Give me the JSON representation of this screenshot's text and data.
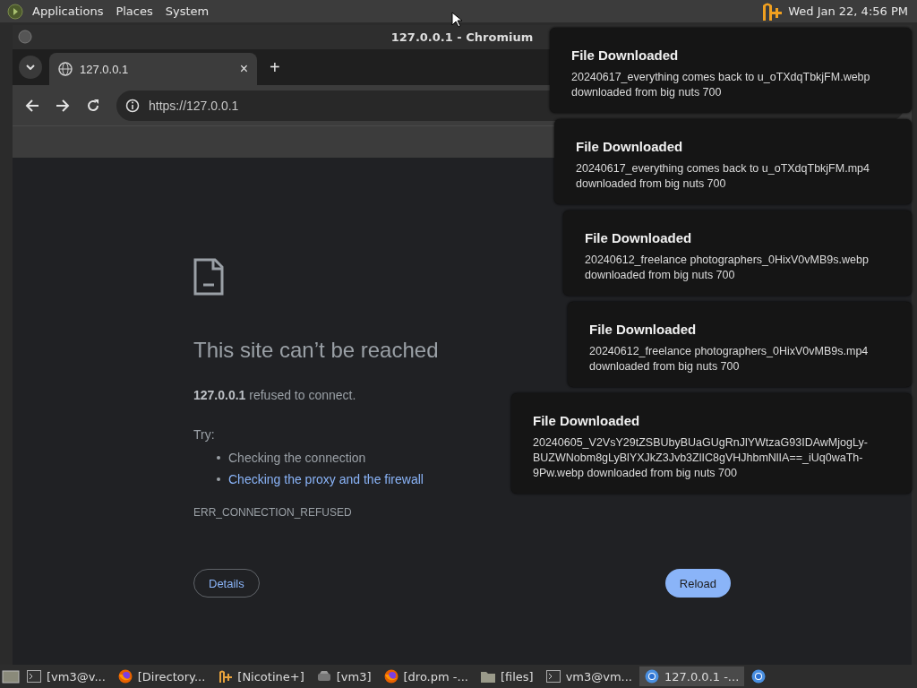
{
  "top_panel": {
    "menus": [
      "Applications",
      "Places",
      "System"
    ],
    "clock": "Wed Jan 22,  4:56 PM"
  },
  "window": {
    "title": "127.0.0.1 - Chromium"
  },
  "tabs": [
    {
      "label": "127.0.0.1",
      "close": "×",
      "selected": true
    }
  ],
  "new_tab": "+",
  "address_bar": {
    "value": "https://127.0.0.1"
  },
  "error_page": {
    "heading": "This site can’t be reached",
    "message": "**127.0.0.1** refused to connect.",
    "try_label": "Try:",
    "suggestions": [
      {
        "text": "Checking the connection",
        "kind": "text"
      },
      {
        "text": "Checking the proxy and the firewall",
        "kind": "link"
      }
    ],
    "code": "ERR_CONNECTION_REFUSED",
    "details_button": "Details",
    "reload_button": "Reload"
  },
  "notifications": [
    {
      "title": "File Downloaded",
      "body": "20240617_everything comes back to u_oTXdqTbkjFM.webp downloaded from big nuts 700"
    },
    {
      "title": "File Downloaded",
      "body": "20240617_everything comes back to u_oTXdqTbkjFM.mp4 downloaded from big nuts 700"
    },
    {
      "title": "File Downloaded",
      "body": "20240612_freelance photographers_0HixV0vMB9s.webp downloaded from big nuts 700"
    },
    {
      "title": "File Downloaded",
      "body": "20240612_freelance photographers_0HixV0vMB9s.mp4 downloaded from big nuts 700"
    },
    {
      "title": "File Downloaded",
      "body": "20240605_V2VsY29tZSBUbyBUaGUgRnJlYWtzaG93IDAwMjogLy-BUZWNobm8gLyBlYXJkZ3Jvb3ZlIC8gVHJhbmNlIA==_iUq0waTh-9Pw.webp downloaded from big nuts 700"
    }
  ],
  "taskbar": [
    {
      "kind": "terminal",
      "label": "[vm3@v...",
      "selected": false
    },
    {
      "kind": "firefox",
      "label": "[Directory...",
      "selected": false
    },
    {
      "kind": "nicotine",
      "label": "[Nicotine+]",
      "selected": false
    },
    {
      "kind": "drive",
      "label": "[vm3]",
      "selected": false
    },
    {
      "kind": "firefox",
      "label": "[dro.pm -...",
      "selected": false
    },
    {
      "kind": "folder",
      "label": "[files]",
      "selected": false
    },
    {
      "kind": "terminal",
      "label": "vm3@vm...",
      "selected": false
    },
    {
      "kind": "chromium",
      "label": "127.0.0.1 -...",
      "selected": true
    },
    {
      "kind": "chromium",
      "selected": false
    }
  ]
}
